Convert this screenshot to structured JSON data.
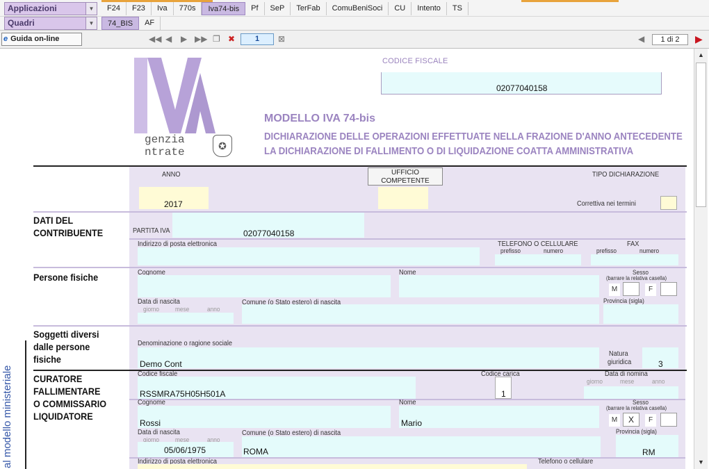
{
  "menu": {
    "applicazioni": "Applicazioni",
    "quadri": "Quadri",
    "tabs_row1": [
      "F24",
      "F23",
      "Iva",
      "770s",
      "Iva74-bis",
      "Pf",
      "SeP",
      "TerFab",
      "ComuBeniSoci",
      "CU",
      "Intento",
      "TS"
    ],
    "active_tab": "Iva74-bis",
    "tabs_row2": [
      "74_BIS",
      "AF"
    ],
    "active_tab2": "74_BIS"
  },
  "toolbar": {
    "guida": "Guida on-line",
    "page": "1",
    "page_indicator": "1 di 2"
  },
  "form": {
    "cf_label": "CODICE FISCALE",
    "cf_value": "02077040158",
    "model_title": "MODELLO IVA 74-bis",
    "subtitle1": "DICHIARAZIONE DELLE OPERAZIONI EFFETTUATE NELLA FRAZIONE D'ANNO ANTECEDENTE",
    "subtitle2": "LA DICHIARAZIONE DI FALLIMENTO O DI LIQUIDAZIONE COATTA AMMINISTRATIVA",
    "logo_letters": "IVA",
    "agenzia_1": "genzia",
    "agenzia_2": "ntrate",
    "anno_label": "ANNO",
    "anno_value": "2017",
    "ufficio_label_1": "UFFICIO",
    "ufficio_label_2": "COMPETENTE",
    "tipo_dich": "TIPO DICHIARAZIONE",
    "correttiva": "Correttiva nei termini",
    "sec_dati_1": "DATI DEL",
    "sec_dati_2": "CONTRIBUENTE",
    "partita_iva_label": "PARTITA IVA",
    "partita_iva_value": "02077040158",
    "email_label": "Indirizzo di posta elettronica",
    "tel_label": "TELEFONO O CELLULARE",
    "fax_label": "FAX",
    "prefisso": "prefisso",
    "numero": "numero",
    "sec_persone": "Persone fisiche",
    "cognome": "Cognome",
    "nome": "Nome",
    "sesso": "Sesso",
    "sesso_sub": "(barrare la relativa casella)",
    "m": "M",
    "f": "F",
    "data_nascita": "Data di nascita",
    "giorno": "giorno",
    "mese": "mese",
    "anno_small": "anno",
    "comune_nascita": "Comune (o Stato estero) di nascita",
    "provincia": "Provincia (sigla)",
    "sec_soggetti_1": "Soggetti diversi",
    "sec_soggetti_2": "dalle persone",
    "sec_soggetti_3": "fisiche",
    "denominazione": "Denominazione o ragione sociale",
    "denominazione_value": "Demo Cont",
    "natura_1": "Natura",
    "natura_2": "giuridica",
    "natura_value": "3",
    "sec_curatore_1": "CURATORE",
    "sec_curatore_2": "FALLIMENTARE",
    "sec_curatore_3": "O COMMISSARIO",
    "sec_curatore_4": "LIQUIDATORE",
    "cf_small": "Codice fiscale",
    "cur_cf_value": "RSSMRA75H05H501A",
    "codice_carica": "Codice carica",
    "codice_carica_value": "1",
    "data_nomina": "Data di nomina",
    "cur_cognome_value": "Rossi",
    "cur_nome_value": "Mario",
    "cur_sesso_value": "X",
    "cur_data_value": "05/06/1975",
    "cur_comune_value": "ROMA",
    "cur_provincia_value": "RM",
    "telefono_cell": "Telefono o cellulare",
    "side_text": "al modello ministeriale"
  },
  "colors": {
    "accent": "#9b84c0",
    "field": "#e4fbfb",
    "section": "#e9e3f2",
    "yellow": "#fffbd6"
  }
}
